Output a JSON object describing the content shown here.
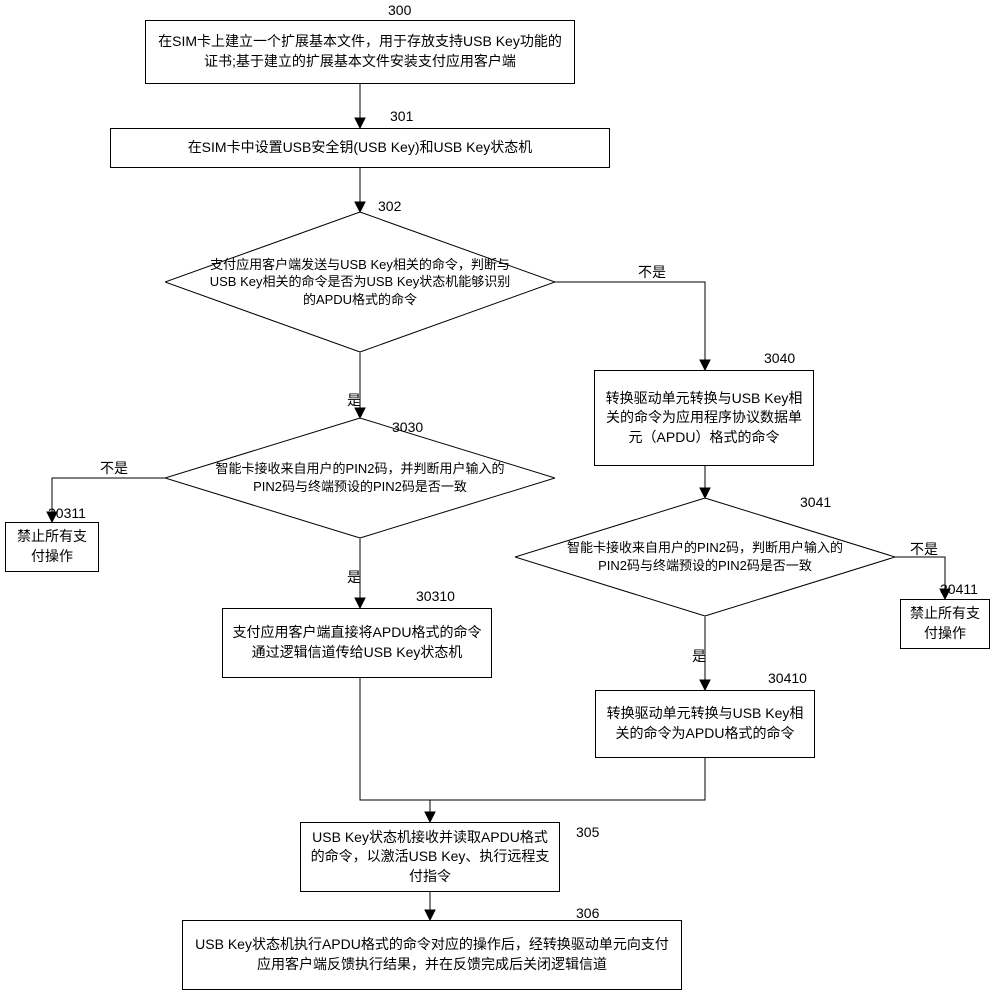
{
  "nodes": {
    "n300": "在SIM卡上建立一个扩展基本文件，用于存放支持USB Key功能的证书;基于建立的扩展基本文件安装支付应用客户端",
    "n301": "在SIM卡中设置USB安全钥(USB Key)和USB Key状态机",
    "n302": "支付应用客户端发送与USB Key相关的命令，判断与USB Key相关的命令是否为USB Key状态机能够识别的APDU格式的命令",
    "n3030": "智能卡接收来自用户的PIN2码，并判断用户输入的PIN2码与终端预设的PIN2码是否一致",
    "n30310": "支付应用客户端直接将APDU格式的命令通过逻辑信道传给USB Key状态机",
    "n30311": "禁止所有支付操作",
    "n3040": "转换驱动单元转换与USB Key相关的命令为应用程序协议数据单元（APDU）格式的命令",
    "n3041": "智能卡接收来自用户的PIN2码，判断用户输入的PIN2码与终端预设的PIN2码是否一致",
    "n30410": "转换驱动单元转换与USB Key相关的命令为APDU格式的命令",
    "n30411": "禁止所有支付操作",
    "n305": "USB Key状态机接收并读取APDU格式的命令，以激活USB Key、执行远程支付指令",
    "n306": "USB Key状态机执行APDU格式的命令对应的操作后，经转换驱动单元向支付应用客户端反馈执行结果，并在反馈完成后关闭逻辑信道"
  },
  "refs": {
    "r300": "300",
    "r301": "301",
    "r302": "302",
    "r3030": "3030",
    "r30310": "30310",
    "r30311": "30311",
    "r3040": "3040",
    "r3041": "3041",
    "r30410": "30410",
    "r30411": "30411",
    "r305": "305",
    "r306": "306"
  },
  "edge_labels": {
    "yes": "是",
    "no": "不是"
  }
}
